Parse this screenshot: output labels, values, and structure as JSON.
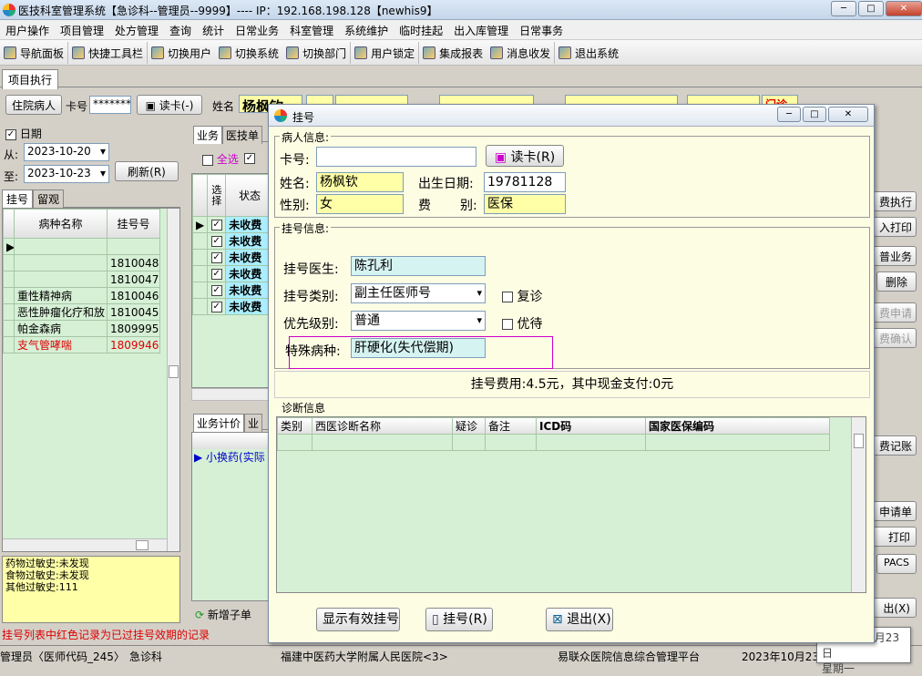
{
  "window": {
    "title": "医技科室管理系统【急诊科--管理员--9999】---- IP：192.168.198.128【newhis9】"
  },
  "menu": [
    "用户操作",
    "项目管理",
    "处方管理",
    "查询",
    "统计",
    "日常业务",
    "科室管理",
    "系统维护",
    "临时挂起",
    "出入库管理",
    "日常事务"
  ],
  "toolbar": [
    "导航面板",
    "快捷工具栏",
    "切换用户",
    "切换系统",
    "切换部门",
    "用户锁定",
    "集成报表",
    "消息收发",
    "退出系统"
  ],
  "main_tab": "项目执行",
  "patient": {
    "type": "住院病人",
    "card_label": "卡号",
    "card_value": "*******",
    "read_card": "读卡(-)",
    "name_label": "姓名",
    "name_value": "杨枫钦",
    "extra": "门诊"
  },
  "left": {
    "date_check": "日期",
    "from_label": "从:",
    "from_value": "2023-10-20",
    "to_label": "至:",
    "to_value": "2023-10-23",
    "refresh": "刷新(R)",
    "tabs": [
      "挂号",
      "留观"
    ],
    "cols": [
      "病种名称",
      "挂号号"
    ],
    "rows": [
      {
        "name": "",
        "no": ""
      },
      {
        "name": "",
        "no": "1810048"
      },
      {
        "name": "",
        "no": "1810047"
      },
      {
        "name": "重性精神病",
        "no": "1810046"
      },
      {
        "name": "恶性肿瘤化疗和放",
        "no": "1810045"
      },
      {
        "name": "帕金森病",
        "no": "1809995"
      },
      {
        "name": "支气管哮喘",
        "no": "1809946",
        "red": true
      }
    ],
    "allergy": [
      "药物过敏史:未发现",
      "食物过敏史:未发现",
      "其他过敏史:111"
    ]
  },
  "middle": {
    "tabs": [
      "业务",
      "医技单"
    ],
    "select_all": "全选",
    "cols": [
      "选择",
      "状态"
    ],
    "status": [
      "未收费",
      "未收费",
      "未收费",
      "未收费",
      "未收费",
      "未收费"
    ],
    "tabs2": [
      "业务计价",
      "业"
    ],
    "row2": "小换药(实际",
    "add_child": "新增子单"
  },
  "right_buttons": [
    "费执行",
    "入打印",
    "普业务",
    "删除",
    "费申请",
    "费确认",
    "费记账",
    "申请单",
    "打印",
    "PACS",
    "出(X)"
  ],
  "hint": "挂号列表中红色记录为已过挂号效期的记录",
  "status": {
    "user": "管理员〈医师代码_245〉",
    "dept": "急诊科",
    "hospital": "福建中医药大学附属人民医院<3>",
    "platform": "易联众医院信息综合管理平台",
    "date": "2023年10月23日"
  },
  "tooltip": {
    "date": "2023年10月23日",
    "weekday": "星期一"
  },
  "dialog": {
    "title": "挂号",
    "patient_group": "病人信息:",
    "card_label": "卡号:",
    "card_value": "",
    "read_card": "读卡(R)",
    "name_label": "姓名:",
    "name_value": "杨枫钦",
    "dob_label": "出生日期:",
    "dob_value": "19781128",
    "sex_label": "性别:",
    "sex_value": "女",
    "fee_label1": "费",
    "fee_label2": "别:",
    "fee_value": "医保",
    "reg_group": "挂号信息:",
    "doctor_label": "挂号医生:",
    "doctor_value": "陈孔利",
    "type_label": "挂号类别:",
    "type_value": "副主任医师号",
    "revisit": "复诊",
    "priority_label": "优先级别:",
    "priority_value": "普通",
    "priority_wait": "优待",
    "disease_label": "特殊病种:",
    "disease_value": "肝硬化(失代偿期)",
    "fee_text": "挂号费用:4.5元，其中现金支付:0元",
    "diag_group": "诊断信息",
    "diag_cols": [
      "类别",
      "西医诊断名称",
      "疑诊",
      "备注",
      "ICD码",
      "国家医保编码"
    ],
    "btn_show": "显示有效挂号",
    "btn_reg": "挂号(R)",
    "btn_exit": "退出(X)"
  }
}
